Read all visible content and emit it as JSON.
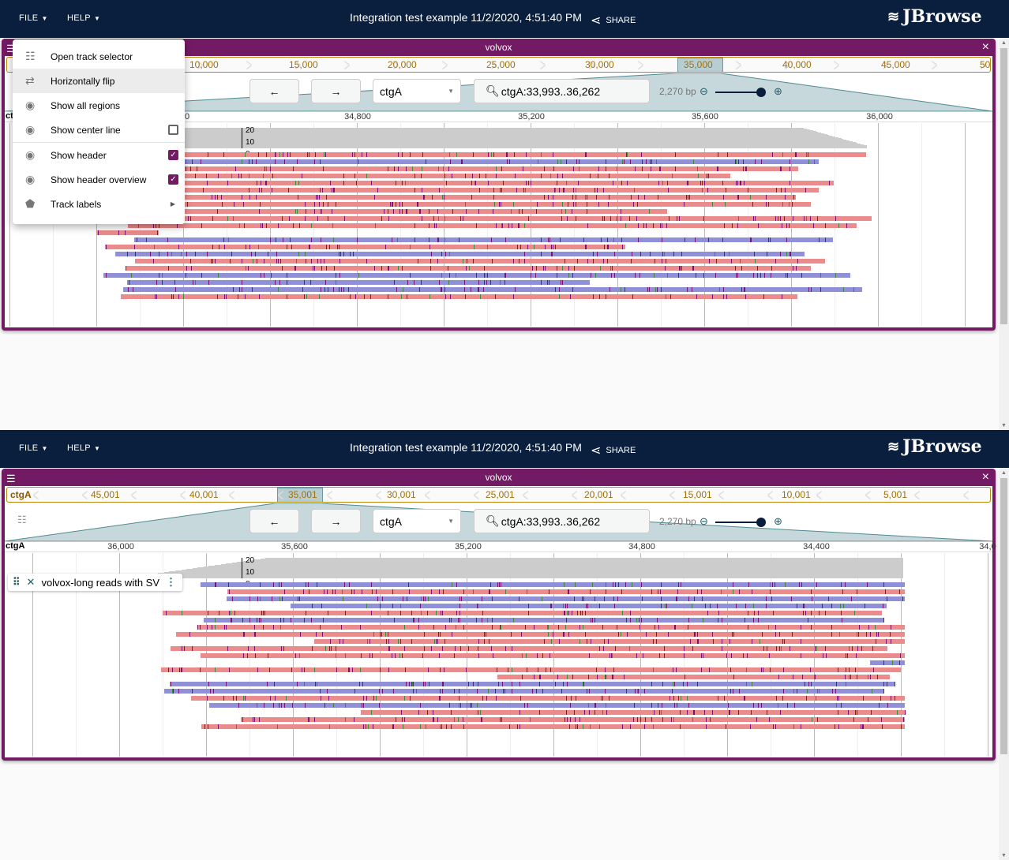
{
  "app": {
    "file_label": "FILE",
    "help_label": "HELP",
    "title": "Integration test example 11/2/2020, 4:51:40 PM",
    "share_label": "SHARE",
    "logo_text": "JBrowse"
  },
  "view": {
    "name": "volvox",
    "refname": "ctgA",
    "location": "ctgA:33,993..36,262",
    "bp": "2,270 bp",
    "zoom_level": 0.95,
    "assembly_select": "ctgA"
  },
  "top": {
    "overview_labels": [
      "10,000",
      "15,000",
      "20,000",
      "25,000",
      "30,000",
      "35,000",
      "40,000",
      "45,000",
      "50,"
    ],
    "ruler_ticks": [
      "00",
      "34,800",
      "35,200",
      "35,600",
      "36,000"
    ],
    "ctg_label_partial": "ct"
  },
  "bottom": {
    "overview_labels": [
      "ctgA",
      "45,001",
      "40,001",
      "35,001",
      "30,001",
      "25,001",
      "20,001",
      "15,001",
      "10,001",
      "5,001"
    ],
    "ruler_ticks": [
      "36,000",
      "35,600",
      "35,200",
      "34,800",
      "34,400",
      "34,0"
    ],
    "ctg_label": "ctgA",
    "track_label": "volvox-long reads with SV"
  },
  "coverage_axis": [
    "20",
    "10",
    "0"
  ],
  "menu": {
    "items": [
      {
        "label": "Open track selector",
        "icon": "track-selector-icon"
      },
      {
        "label": "Horizontally flip",
        "icon": "swap-icon"
      },
      {
        "label": "Show all regions",
        "icon": "eye-icon"
      },
      {
        "label": "Show center line",
        "icon": "eye-icon",
        "checked": false
      },
      {
        "label": "Show header",
        "icon": "eye-icon",
        "checked": true
      },
      {
        "label": "Show header overview",
        "icon": "eye-icon",
        "checked": true
      },
      {
        "label": "Track labels",
        "icon": "label-icon"
      }
    ]
  },
  "colors": {
    "appbar": "#0a1f3e",
    "view_header": "#721a63",
    "overview_label": "#a0700a",
    "forward_read": "#ec8b8b",
    "reverse_read": "#8f90d8",
    "coverage": "#cccccc"
  }
}
